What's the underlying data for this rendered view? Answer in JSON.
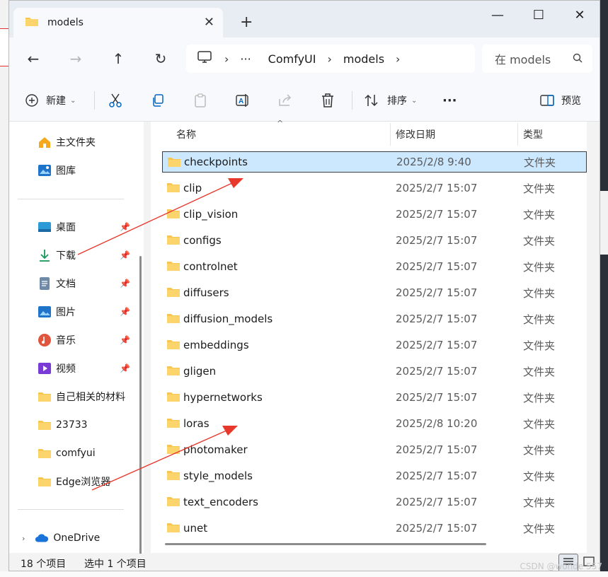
{
  "window": {
    "tab_title": "models",
    "new_tab": "+"
  },
  "address": {
    "overflow": "···",
    "breadcrumbs": [
      "ComfyUI",
      "models"
    ],
    "search_placeholder": "在 models"
  },
  "toolbar": {
    "new_label": "新建",
    "sort_label": "排序",
    "more_label": "···",
    "preview_label": "预览"
  },
  "sidebar": {
    "top": [
      {
        "label": "主文件夹",
        "icon": "home-icon"
      },
      {
        "label": "图库",
        "icon": "gallery-icon"
      }
    ],
    "pinned": [
      {
        "label": "桌面",
        "icon": "desktop-icon"
      },
      {
        "label": "下载",
        "icon": "download-icon"
      },
      {
        "label": "文档",
        "icon": "document-icon"
      },
      {
        "label": "图片",
        "icon": "picture-icon"
      },
      {
        "label": "音乐",
        "icon": "music-icon"
      },
      {
        "label": "视频",
        "icon": "video-icon"
      }
    ],
    "folders": [
      {
        "label": "自己相关的材料"
      },
      {
        "label": "23733"
      },
      {
        "label": "comfyui"
      },
      {
        "label": "Edge浏览器"
      }
    ],
    "onedrive": "OneDrive"
  },
  "list": {
    "columns": {
      "name": "名称",
      "date": "修改日期",
      "type": "类型"
    },
    "rows": [
      {
        "name": "checkpoints",
        "date": "2025/2/8 9:40",
        "type": "文件夹",
        "selected": true
      },
      {
        "name": "clip",
        "date": "2025/2/7 15:07",
        "type": "文件夹"
      },
      {
        "name": "clip_vision",
        "date": "2025/2/7 15:07",
        "type": "文件夹"
      },
      {
        "name": "configs",
        "date": "2025/2/7 15:07",
        "type": "文件夹"
      },
      {
        "name": "controlnet",
        "date": "2025/2/7 15:07",
        "type": "文件夹"
      },
      {
        "name": "diffusers",
        "date": "2025/2/7 15:07",
        "type": "文件夹"
      },
      {
        "name": "diffusion_models",
        "date": "2025/2/7 15:07",
        "type": "文件夹"
      },
      {
        "name": "embeddings",
        "date": "2025/2/7 15:07",
        "type": "文件夹"
      },
      {
        "name": "gligen",
        "date": "2025/2/7 15:07",
        "type": "文件夹"
      },
      {
        "name": "hypernetworks",
        "date": "2025/2/7 15:07",
        "type": "文件夹"
      },
      {
        "name": "loras",
        "date": "2025/2/8 10:20",
        "type": "文件夹"
      },
      {
        "name": "photomaker",
        "date": "2025/2/7 15:07",
        "type": "文件夹"
      },
      {
        "name": "style_models",
        "date": "2025/2/7 15:07",
        "type": "文件夹"
      },
      {
        "name": "text_encoders",
        "date": "2025/2/7 15:07",
        "type": "文件夹"
      },
      {
        "name": "unet",
        "date": "2025/2/7 15:07",
        "type": "文件夹"
      }
    ]
  },
  "status": {
    "count": "18 个项目",
    "selection": "选中 1 个项目"
  },
  "watermark": "CSDN @wonde 557",
  "colors": {
    "accent": "#0067c0",
    "selection": "#cce8ff",
    "folder": "#f8c54e",
    "arrow": "#e8382b"
  }
}
